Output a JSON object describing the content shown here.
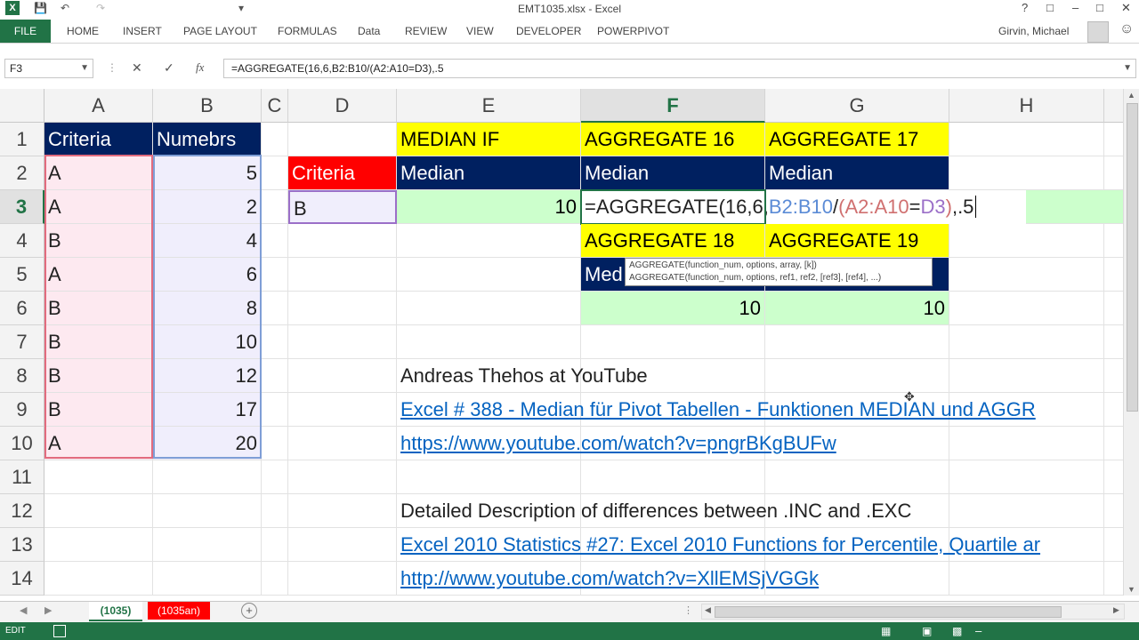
{
  "window": {
    "title": "EMT1035.xlsx - Excel",
    "user": "Girvin, Michael"
  },
  "ribbon_tabs": [
    "FILE",
    "HOME",
    "INSERT",
    "PAGE LAYOUT",
    "FORMULAS",
    "Data",
    "REVIEW",
    "VIEW",
    "DEVELOPER",
    "POWERPIVOT"
  ],
  "name_box": "F3",
  "formula": "=AGGREGATE(16,6,B2:B10/(A2:A10=D3),.5",
  "fx_label": "fx",
  "columns": [
    "A",
    "B",
    "C",
    "D",
    "E",
    "F",
    "G",
    "H"
  ],
  "rows": [
    "1",
    "2",
    "3",
    "4",
    "5",
    "6",
    "7",
    "8",
    "9",
    "10",
    "11",
    "12",
    "13",
    "14"
  ],
  "cells": {
    "A1": "Criteria",
    "B1": "Numebrs",
    "A2": "A",
    "B2": "5",
    "A3": "A",
    "B3": "2",
    "A4": "B",
    "B4": "4",
    "A5": "A",
    "B5": "6",
    "A6": "B",
    "B6": "8",
    "A7": "B",
    "B7": "10",
    "A8": "B",
    "B8": "12",
    "A9": "B",
    "B9": "17",
    "A10": "A",
    "B10": "20",
    "D2": "Criteria",
    "D3": "B",
    "E1": "MEDIAN IF",
    "E2": "Median",
    "E3": "10",
    "F1": "AGGREGATE 16",
    "F2": "Median",
    "F3": "=AGGREGATE(16,6,B2:B10/(A2:A10=D3),.5",
    "G1": "AGGREGATE 17",
    "G2": "Median",
    "F4": "AGGREGATE 18",
    "G4": "AGGREGATE 19",
    "F5": "Med",
    "F6": "10",
    "G6": "10",
    "E8": "Andreas Thehos at YouTube",
    "E9": "Excel # 388 - Median für Pivot Tabellen - Funktionen MEDIAN und AGGR",
    "E10": "https://www.youtube.com/watch?v=pngrBKgBUFw",
    "E12": "Detailed Description of differences between .INC and .EXC",
    "E13": "Excel 2010 Statistics #27: Excel 2010 Functions for Percentile, Quartile ar",
    "E14": "http://www.youtube.com/watch?v=XllEMSjVGGk"
  },
  "tooltip": {
    "line1": "AGGREGATE(function_num, options, array, [k])",
    "line2": "AGGREGATE(function_num, options, ref1, ref2, [ref3], [ref4], ...)"
  },
  "sheet_tabs": [
    "(1035)",
    "(1035an)"
  ],
  "status": {
    "mode": "EDIT"
  },
  "colors": {
    "accent": "#217346",
    "header_navy": "#002060",
    "yellow": "#ffff00",
    "green": "#ccffcc",
    "red": "#ff0000"
  }
}
